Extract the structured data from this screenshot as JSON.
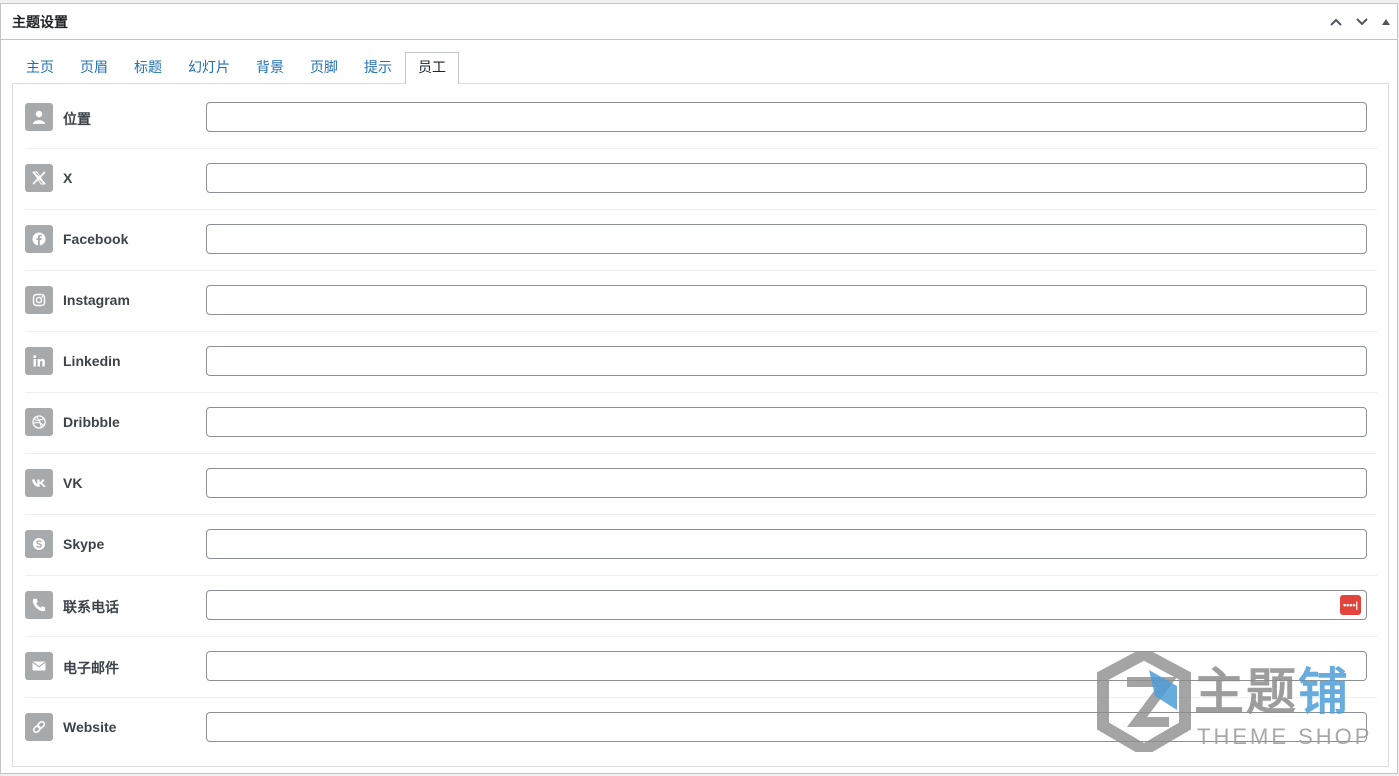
{
  "box": {
    "title": "主题设置",
    "actions": [
      {
        "name": "move-up-button",
        "icon": "chevron-up-icon"
      },
      {
        "name": "move-down-button",
        "icon": "chevron-down-icon"
      },
      {
        "name": "toggle-panel-button",
        "icon": "triangle-up-icon"
      }
    ]
  },
  "tabs": [
    {
      "label": "主页",
      "active": false
    },
    {
      "label": "页眉",
      "active": false
    },
    {
      "label": "标题",
      "active": false
    },
    {
      "label": "幻灯片",
      "active": false
    },
    {
      "label": "背景",
      "active": false
    },
    {
      "label": "页脚",
      "active": false
    },
    {
      "label": "提示",
      "active": false
    },
    {
      "label": "员工",
      "active": true
    }
  ],
  "fields": [
    {
      "label": "位置",
      "icon": "user-icon",
      "value": "",
      "placeholder": ""
    },
    {
      "label": "X",
      "icon": "x-twitter-icon",
      "value": "",
      "placeholder": ""
    },
    {
      "label": "Facebook",
      "icon": "facebook-icon",
      "value": "",
      "placeholder": ""
    },
    {
      "label": "Instagram",
      "icon": "instagram-icon",
      "value": "",
      "placeholder": ""
    },
    {
      "label": "Linkedin",
      "icon": "linkedin-icon",
      "value": "",
      "placeholder": ""
    },
    {
      "label": "Dribbble",
      "icon": "dribbble-icon",
      "value": "",
      "placeholder": ""
    },
    {
      "label": "VK",
      "icon": "vk-icon",
      "value": "",
      "placeholder": ""
    },
    {
      "label": "Skype",
      "icon": "skype-icon",
      "value": "",
      "placeholder": ""
    },
    {
      "label": "联系电话",
      "icon": "phone-icon",
      "value": "",
      "placeholder": "",
      "password_manager_badge": "••••|"
    },
    {
      "label": "电子邮件",
      "icon": "envelope-icon",
      "value": "",
      "placeholder": ""
    },
    {
      "label": "Website",
      "icon": "link-icon",
      "value": "",
      "placeholder": ""
    }
  ],
  "watermark": {
    "brand_cn_gray": "主题",
    "brand_cn_blue": "铺",
    "brand_en": "THEME SHOP"
  },
  "colors": {
    "link": "#2271b1",
    "icon_bg": "#a7aaad",
    "badge": "#e2433b",
    "watermark_blue": "#4e9ed8"
  }
}
